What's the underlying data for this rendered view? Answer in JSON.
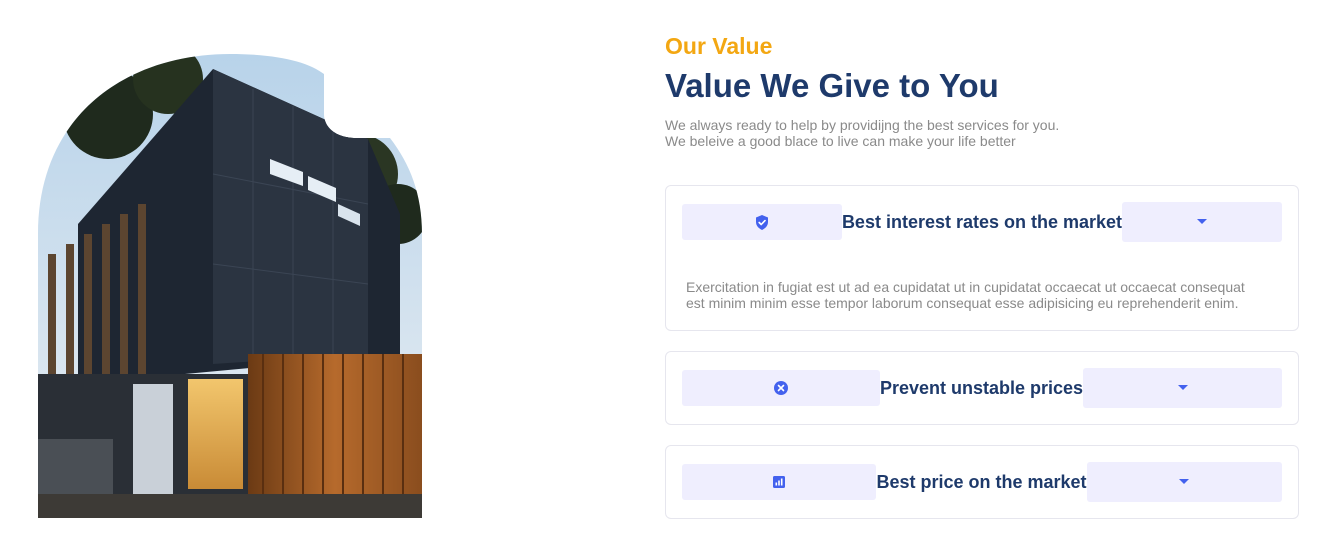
{
  "section": {
    "eyebrow": "Our Value",
    "title": "Value We Give to You",
    "subtitle_lines": [
      "We always ready to help by providijng the best services for you.",
      "We beleive a good blace to live can make your life better"
    ]
  },
  "accordion": [
    {
      "title": "Best interest rates on the market",
      "icon": "shield-check-icon",
      "expanded": true,
      "body": "Exercitation in fugiat est ut ad ea cupidatat ut in cupidatat occaecat ut occaecat consequat est minim minim esse tempor laborum consequat esse adipisicing eu reprehenderit enim."
    },
    {
      "title": "Prevent unstable prices",
      "icon": "x-circle-icon",
      "expanded": false
    },
    {
      "title": "Best price on the market",
      "icon": "bar-chart-icon",
      "expanded": false
    }
  ],
  "colors": {
    "accent": "#f3a712",
    "heading": "#1e3a6b",
    "muted": "#8a8a8a",
    "pill": "#efeefe",
    "icon": "#4361ee"
  }
}
